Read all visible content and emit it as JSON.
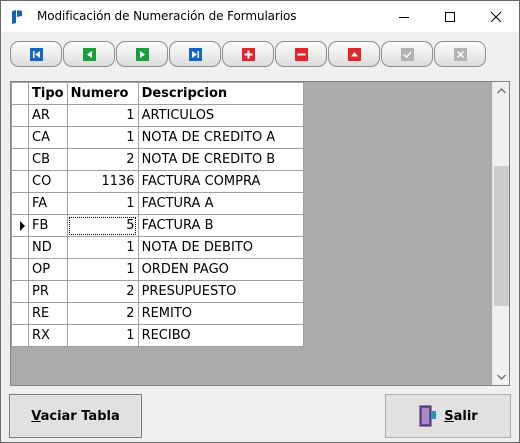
{
  "window": {
    "title": "Modificación de Numeración de Formularios"
  },
  "titlebar_controls": {
    "minimize_icon": "minimize-icon",
    "maximize_icon": "maximize-icon",
    "close_icon": "close-icon"
  },
  "navigator": {
    "buttons": [
      {
        "name": "first",
        "icon": "first-record-icon",
        "color": "#1565c0",
        "enabled": true
      },
      {
        "name": "prior",
        "icon": "prior-record-icon",
        "color": "#1e9e3a",
        "enabled": true
      },
      {
        "name": "next",
        "icon": "next-record-icon",
        "color": "#1e9e3a",
        "enabled": true
      },
      {
        "name": "last",
        "icon": "last-record-icon",
        "color": "#1565c0",
        "enabled": true
      },
      {
        "name": "insert",
        "icon": "plus-icon",
        "color": "#e0262a",
        "enabled": true
      },
      {
        "name": "delete",
        "icon": "minus-icon",
        "color": "#e0262a",
        "enabled": true
      },
      {
        "name": "edit",
        "icon": "edit-triangle-icon",
        "color": "#e0262a",
        "enabled": true
      },
      {
        "name": "post",
        "icon": "check-icon",
        "color": "#b3b3b3",
        "enabled": false
      },
      {
        "name": "cancel",
        "icon": "cancel-icon",
        "color": "#b3b3b3",
        "enabled": false
      }
    ]
  },
  "grid": {
    "columns": [
      "Tipo",
      "Numero",
      "Descripcion"
    ],
    "current_row_index": 5,
    "rows": [
      {
        "tipo": "AR",
        "numero": "1",
        "descripcion": "ARTICULOS"
      },
      {
        "tipo": "CA",
        "numero": "1",
        "descripcion": "NOTA DE CREDITO A"
      },
      {
        "tipo": "CB",
        "numero": "2",
        "descripcion": "NOTA DE CREDITO B"
      },
      {
        "tipo": "CO",
        "numero": "1136",
        "descripcion": "FACTURA COMPRA"
      },
      {
        "tipo": "FA",
        "numero": "1",
        "descripcion": "FACTURA A"
      },
      {
        "tipo": "FB",
        "numero": "5",
        "descripcion": "FACTURA B"
      },
      {
        "tipo": "ND",
        "numero": "1",
        "descripcion": "NOTA DE DEBITO"
      },
      {
        "tipo": "OP",
        "numero": "1",
        "descripcion": "ORDEN PAGO"
      },
      {
        "tipo": "PR",
        "numero": "2",
        "descripcion": "PRESUPUESTO"
      },
      {
        "tipo": "RE",
        "numero": "2",
        "descripcion": "REMITO"
      },
      {
        "tipo": "RX",
        "numero": "1",
        "descripcion": "RECIBO"
      }
    ]
  },
  "buttons": {
    "vaciar_label": "Vaciar Tabla",
    "salir_label": "Salir",
    "salir_icon": "exit-door-icon"
  }
}
